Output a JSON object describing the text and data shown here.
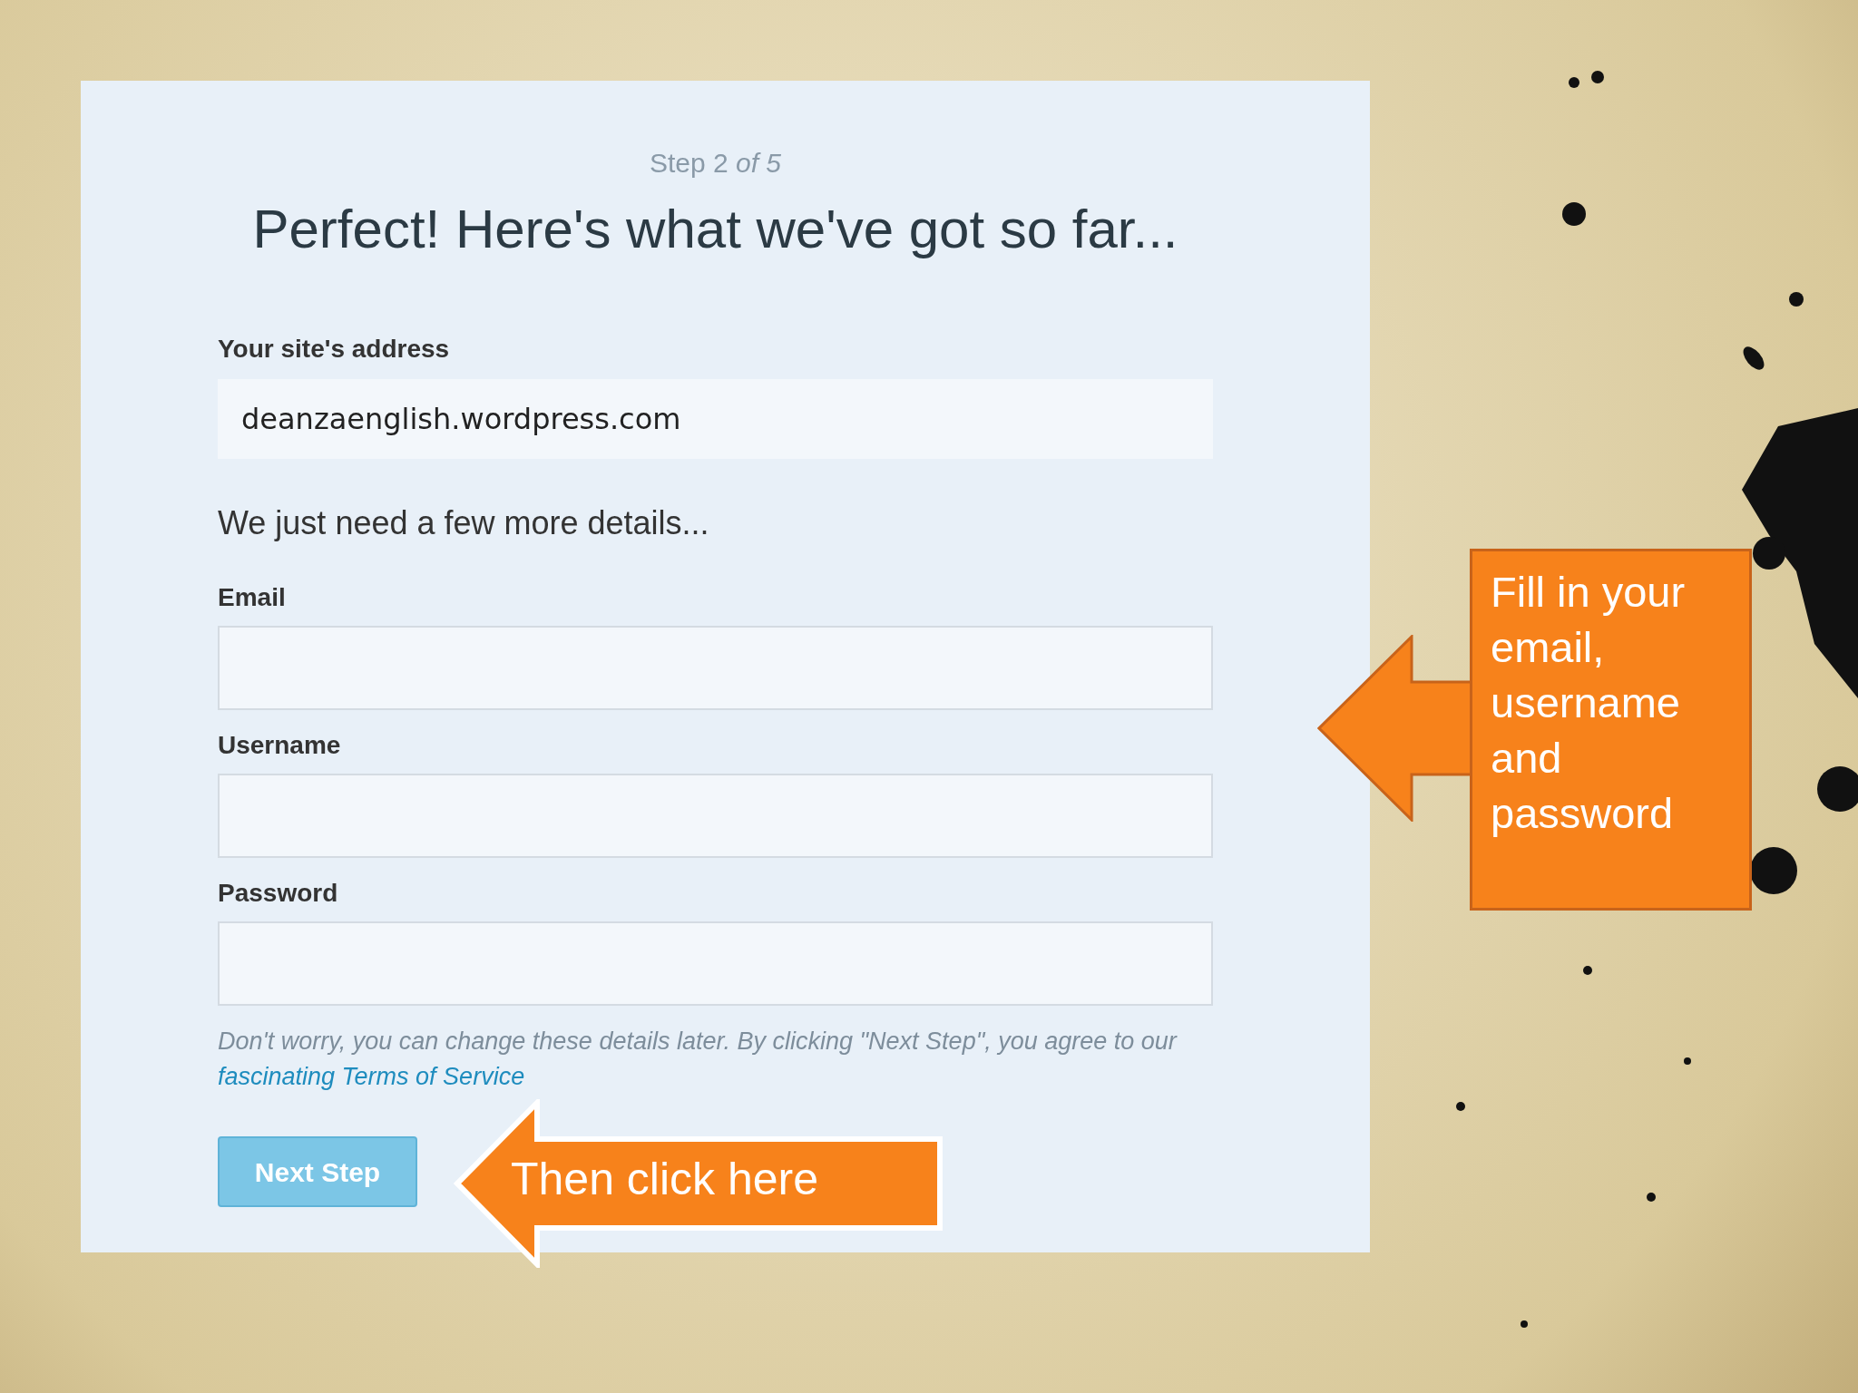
{
  "form": {
    "step": "Step 2 *of 5*",
    "heading": "Perfect! Here's what we've got so far...",
    "site_address": {
      "label": "Your site's address",
      "value": "deanzaenglish.wordpress.com"
    },
    "subheading": "We just need a few more details...",
    "fields": [
      {
        "label": "Email"
      },
      {
        "label": "Username"
      },
      {
        "label": "Password"
      }
    ],
    "note": {
      "text": "Don't worry, you can change these details later. By clicking \"Next Step\", you agree to our",
      "link": "fascinating Terms of Service"
    },
    "button": {
      "label": "Next Step",
      "disabled": true
    }
  },
  "callouts": [
    {
      "kind": "box",
      "text": "Fill in your email, username and password"
    },
    {
      "kind": "arrow",
      "text": "Then click here"
    }
  ]
}
